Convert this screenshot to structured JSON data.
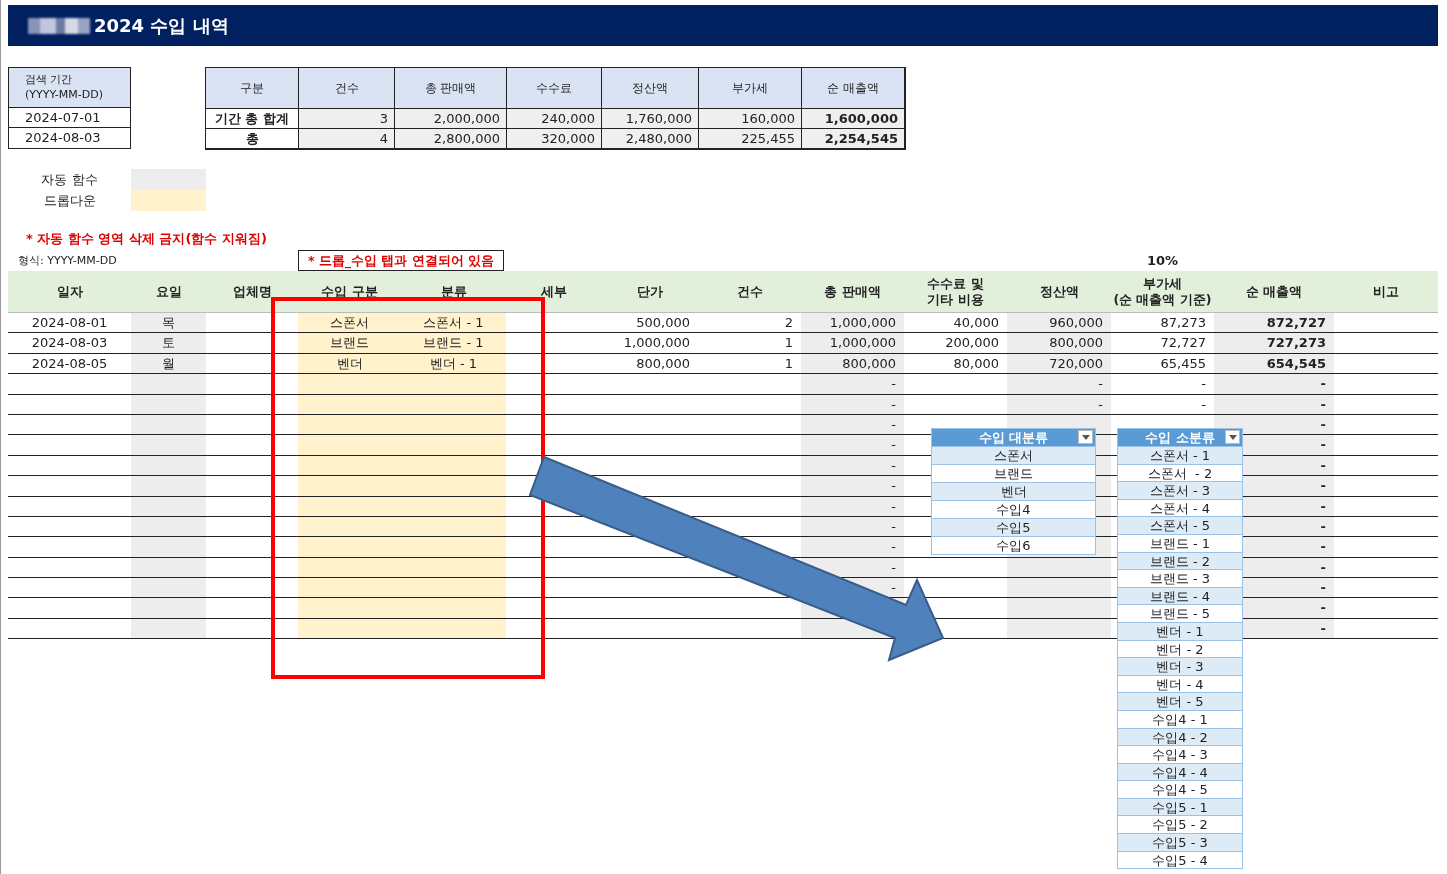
{
  "title": "2024 수입 내역",
  "search_period": {
    "label": "검색 기간\n(YYYY-MM-DD)",
    "values": [
      "2024-07-01",
      "2024-08-03"
    ]
  },
  "summary": {
    "columns": [
      "구분",
      "건수",
      "총 판매액",
      "수수료",
      "정산액",
      "부가세",
      "순 매출액"
    ],
    "rows": [
      [
        "기간 총 합계",
        "3",
        "2,000,000",
        "240,000",
        "1,760,000",
        "160,000",
        "1,600,000"
      ],
      [
        "총",
        "4",
        "2,800,000",
        "320,000",
        "2,480,000",
        "225,455",
        "2,254,545"
      ]
    ]
  },
  "legend": [
    {
      "label": "자동 함수",
      "kind": "auto"
    },
    {
      "label": "드롭다운",
      "kind": "dropdown"
    }
  ],
  "warning": "* 자동 함수 영역 삭제 금지(함수 지워짐)",
  "format_hint": "형식: YYYY-MM-DD",
  "linked_note": "* 드롭_수입 탭과 연결되어 있음",
  "vat_rate": "10%",
  "table": {
    "columns": [
      {
        "label": "일자",
        "kind": "plain"
      },
      {
        "label": "요일",
        "kind": "auto"
      },
      {
        "label": "업체명",
        "kind": "plain"
      },
      {
        "label": "수입 구분",
        "kind": "dropdown"
      },
      {
        "label": "분류",
        "kind": "dropdown"
      },
      {
        "label": "세부",
        "kind": "plain"
      },
      {
        "label": "단가",
        "kind": "plain"
      },
      {
        "label": "건수",
        "kind": "plain"
      },
      {
        "label": "총 판매액",
        "kind": "auto"
      },
      {
        "label": "수수료 및\n기타 비용",
        "kind": "plain"
      },
      {
        "label": "정산액",
        "kind": "auto"
      },
      {
        "label": "부가세\n(순 매출액 기준)",
        "kind": "plain"
      },
      {
        "label": "순 매출액",
        "kind": "auto"
      },
      {
        "label": "비고",
        "kind": "plain"
      }
    ],
    "rows": [
      [
        "2024-08-01",
        "목",
        null,
        "스폰서",
        "스폰서 - 1",
        null,
        "500,000",
        "2",
        "1,000,000",
        "40,000",
        "960,000",
        "87,273",
        "872,727",
        null
      ],
      [
        "2024-08-03",
        "토",
        null,
        "브랜드",
        "브랜드 - 1",
        null,
        "1,000,000",
        "1",
        "1,000,000",
        "200,000",
        "800,000",
        "72,727",
        "727,273",
        null
      ],
      [
        "2024-08-05",
        "월",
        null,
        "벤더",
        "벤더 - 1",
        null,
        "800,000",
        "1",
        "800,000",
        "80,000",
        "720,000",
        "65,455",
        "654,545",
        null
      ],
      [
        null,
        null,
        null,
        null,
        null,
        null,
        null,
        null,
        "-",
        null,
        "-",
        "-",
        "-",
        null
      ],
      [
        null,
        null,
        null,
        null,
        null,
        null,
        null,
        null,
        "-",
        null,
        "-",
        "-",
        "-",
        null
      ],
      [
        null,
        null,
        null,
        null,
        null,
        null,
        null,
        null,
        "-",
        null,
        null,
        null,
        "-",
        null
      ],
      [
        null,
        null,
        null,
        null,
        null,
        null,
        null,
        null,
        "-",
        null,
        null,
        null,
        "-",
        null
      ],
      [
        null,
        null,
        null,
        null,
        null,
        null,
        null,
        null,
        "-",
        null,
        null,
        null,
        "-",
        null
      ],
      [
        null,
        null,
        null,
        null,
        null,
        null,
        null,
        null,
        "-",
        null,
        null,
        null,
        "-",
        null
      ],
      [
        null,
        null,
        null,
        null,
        null,
        null,
        null,
        null,
        "-",
        null,
        null,
        null,
        "-",
        null
      ],
      [
        null,
        null,
        null,
        null,
        null,
        null,
        null,
        null,
        "-",
        null,
        null,
        null,
        "-",
        null
      ],
      [
        null,
        null,
        null,
        null,
        null,
        null,
        null,
        null,
        "-",
        null,
        null,
        null,
        "-",
        null
      ],
      [
        null,
        null,
        null,
        null,
        null,
        null,
        null,
        null,
        "-",
        null,
        null,
        null,
        "-",
        null
      ],
      [
        null,
        null,
        null,
        null,
        null,
        null,
        null,
        null,
        "-",
        null,
        null,
        null,
        "-",
        null
      ],
      [
        null,
        null,
        null,
        null,
        null,
        null,
        null,
        null,
        null,
        null,
        null,
        null,
        "-",
        null
      ],
      [
        null,
        null,
        null,
        null,
        null,
        null,
        null,
        null,
        null,
        null,
        null,
        null,
        "-",
        null
      ]
    ]
  },
  "major_categories": {
    "header": "수입 대분류",
    "items": [
      "스폰서",
      "브랜드",
      "벤더",
      "수입4",
      "수입5",
      "수입6"
    ]
  },
  "minor_categories": {
    "header": "수입 소분류",
    "items": [
      "스폰서 - 1",
      "스폰서  - 2",
      "스폰서 - 3",
      "스폰서 - 4",
      "스폰서 - 5",
      "브랜드 - 1",
      "브랜드 - 2",
      "브랜드 - 3",
      "브랜드 - 4",
      "브랜드 - 5",
      "벤더 - 1",
      "벤더 - 2",
      "벤더 - 3",
      "벤더 - 4",
      "벤더 - 5",
      "수입4 - 1",
      "수입4 - 2",
      "수입4 - 3",
      "수입4 - 4",
      "수입4 - 5",
      "수입5 - 1",
      "수입5 - 2",
      "수입5 - 3",
      "수입5 - 4"
    ]
  }
}
